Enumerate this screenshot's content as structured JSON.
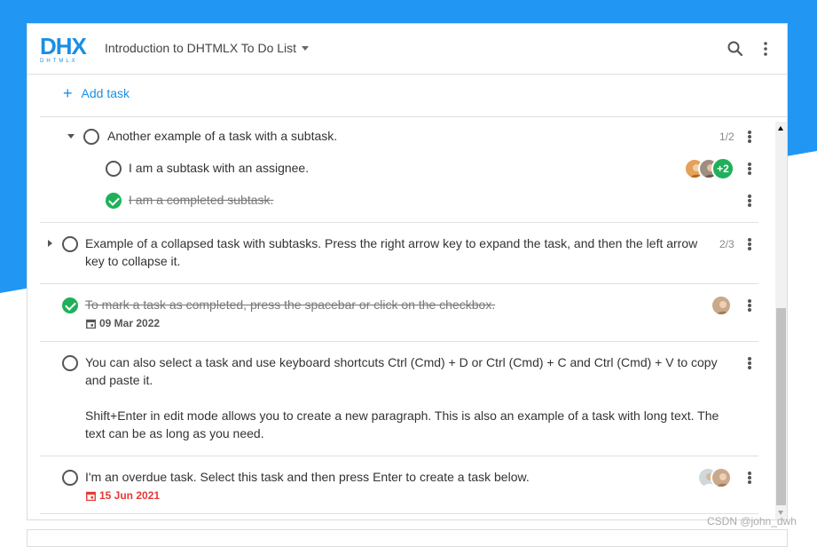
{
  "header": {
    "logo": "DHX",
    "logo_sub": "DHTMLX",
    "project_title": "Introduction to DHTMLX To Do List"
  },
  "add_task": {
    "label": "Add task"
  },
  "tasks": [
    {
      "text": "Another example of a task with a subtask.",
      "count": "1/2",
      "completed": false,
      "expanded": true
    },
    {
      "text": "I am a subtask with an assignee.",
      "completed": false,
      "avatars_extra": "+2"
    },
    {
      "text": "I am a completed subtask.",
      "completed": true
    },
    {
      "text_line1": "Example of a collapsed task with subtasks. Press the right arrow key to expand the task, and then the left arrow",
      "text_line2": "key to collapse it.",
      "count": "2/3",
      "completed": false,
      "expanded": false
    },
    {
      "text": "To mark a task as completed, press the spacebar or click on the checkbox.",
      "completed": true,
      "due": "09 Mar 2022"
    },
    {
      "line1": "You can also select a task and use keyboard shortcuts Ctrl (Cmd) + D or Ctrl (Cmd) + C and Ctrl (Cmd) + V to copy",
      "line2": "and paste it.",
      "line3": "Shift+Enter in edit mode allows you to create a new paragraph. This is also an example of a task with long text. The",
      "line4": "text can be as long as you need.",
      "completed": false
    },
    {
      "text": "I'm an overdue task. Select this task and then press Enter to create a task below.",
      "completed": false,
      "due": "15 Jun 2021",
      "overdue": true
    }
  ],
  "colors": {
    "accent": "#1a8fe3",
    "done": "#20b05a",
    "overdue": "#e53935",
    "background": "#2196f3"
  },
  "watermark": "CSDN @john_dwh"
}
